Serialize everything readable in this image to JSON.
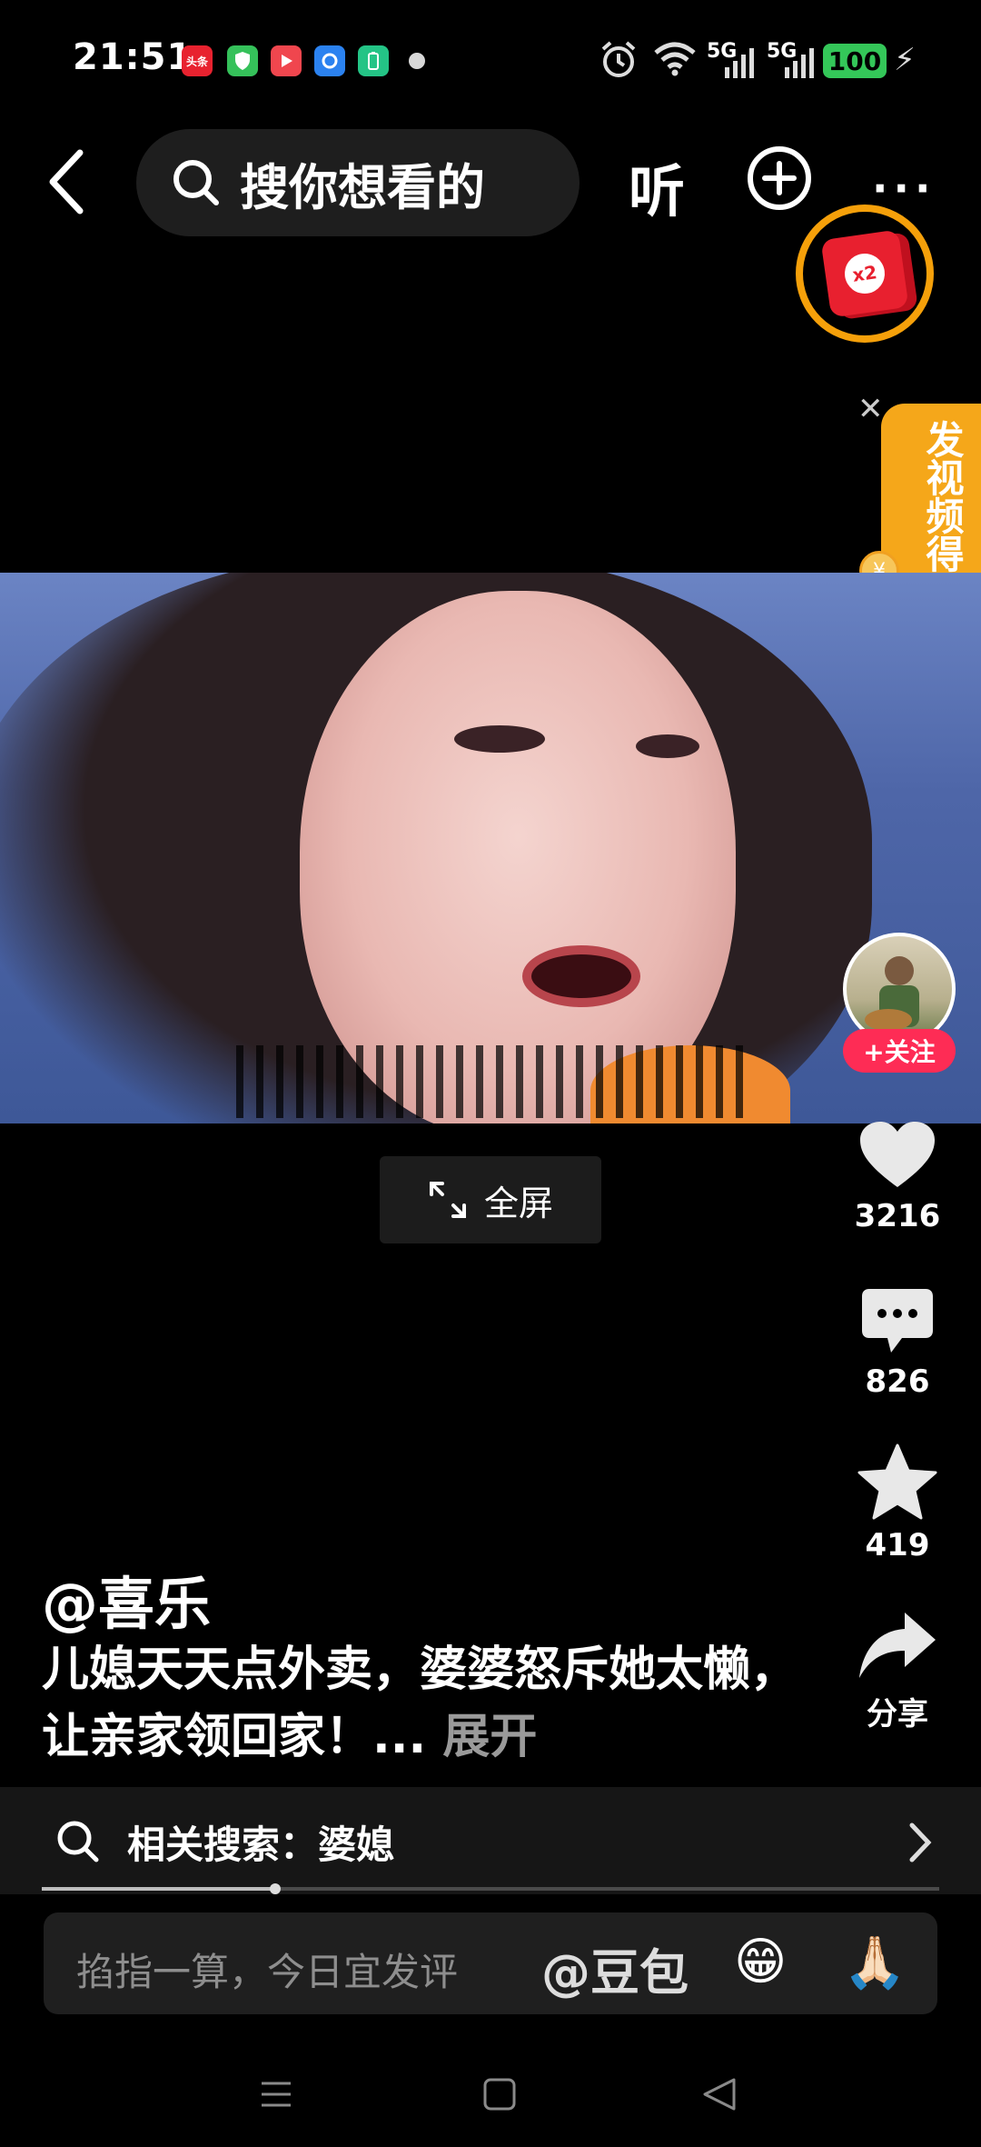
{
  "status_bar": {
    "time": "21:51",
    "apps": [
      {
        "name": "toutiao-icon",
        "label": "头条",
        "color": "#e8222f"
      },
      {
        "name": "shield-app-icon",
        "label": "",
        "color": "#35c15a"
      },
      {
        "name": "video-app-icon",
        "label": "",
        "color": "#f0464e"
      },
      {
        "name": "browser-app-icon",
        "label": "",
        "color": "#2b82f0"
      },
      {
        "name": "battery-app-icon",
        "label": "",
        "color": "#24c486"
      }
    ],
    "signal1": "5G",
    "signal2": "5G",
    "battery": "100"
  },
  "top_bar": {
    "search_placeholder": "搜你想看的",
    "listen_label": "听",
    "more_label": "···"
  },
  "red_packet": {
    "label": "x2"
  },
  "side_banner": {
    "text": "发视频得奖",
    "close": "✕",
    "coin": "¥"
  },
  "video": {
    "fullscreen_label": "全屏"
  },
  "right_actions": {
    "follow_label": "+关注",
    "likes": "3216",
    "comments": "826",
    "favorites": "419",
    "share_label": "分享"
  },
  "caption": {
    "author": "@喜乐",
    "text": "儿媳天天点外卖，婆婆怒斥她太懒，让亲家领回家！...",
    "expand_label": "展开"
  },
  "related_search": {
    "label": "相关搜索：婆媳"
  },
  "progress": {
    "fraction": 0.26
  },
  "comment_bar": {
    "placeholder": "掐指一算，今日宜发评",
    "mention": "@豆包",
    "emoji1": "😁",
    "emoji2": "🙏🏻"
  }
}
